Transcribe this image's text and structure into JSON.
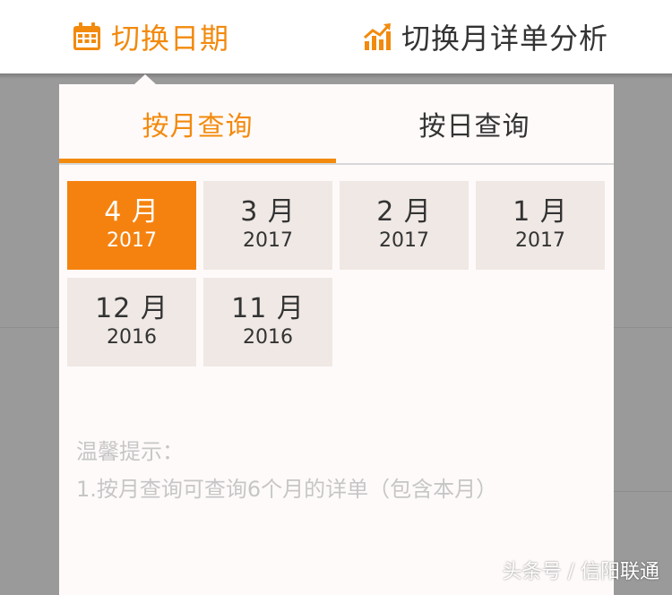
{
  "header": {
    "switch_date_label": "切换日期",
    "switch_analysis_label": "切换月详单分析",
    "date_icon": "calendar-icon",
    "analysis_icon": "trend-chart-icon",
    "accent_color": "#f28a0e"
  },
  "popup": {
    "tabs": [
      {
        "label": "按月查询",
        "active": true
      },
      {
        "label": "按日查询",
        "active": false
      }
    ],
    "months": [
      {
        "month": "4 月",
        "year": "2017",
        "selected": true
      },
      {
        "month": "3 月",
        "year": "2017",
        "selected": false
      },
      {
        "month": "2 月",
        "year": "2017",
        "selected": false
      },
      {
        "month": "1 月",
        "year": "2017",
        "selected": false
      },
      {
        "month": "12 月",
        "year": "2016",
        "selected": false
      },
      {
        "month": "11 月",
        "year": "2016",
        "selected": false
      }
    ],
    "tip_title": "温馨提示：",
    "tip_text": "1.按月查询可查询6个月的详单（包含本月）"
  },
  "watermark": "头条号 / 信阳联通"
}
